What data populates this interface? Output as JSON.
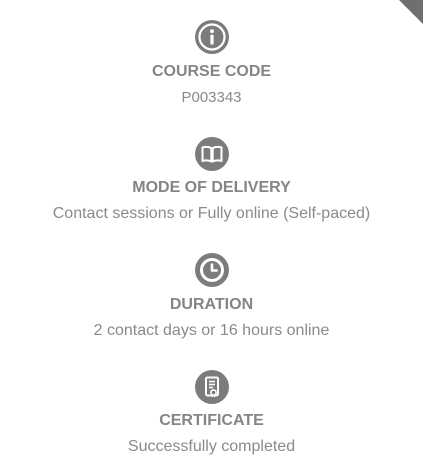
{
  "items": [
    {
      "icon": "info-icon",
      "label": "COURSE CODE",
      "value": "P003343"
    },
    {
      "icon": "book-icon",
      "label": "MODE OF DELIVERY",
      "value": "Contact sessions or Fully online (Self-paced)"
    },
    {
      "icon": "clock-icon",
      "label": "DURATION",
      "value": "2 contact days or 16 hours online"
    },
    {
      "icon": "certificate-icon",
      "label": "CERTIFICATE",
      "value": "Successfully completed"
    }
  ],
  "colors": {
    "icon_background": "#7c7c7c",
    "text": "#858585",
    "corner": "#6f6f6f"
  }
}
